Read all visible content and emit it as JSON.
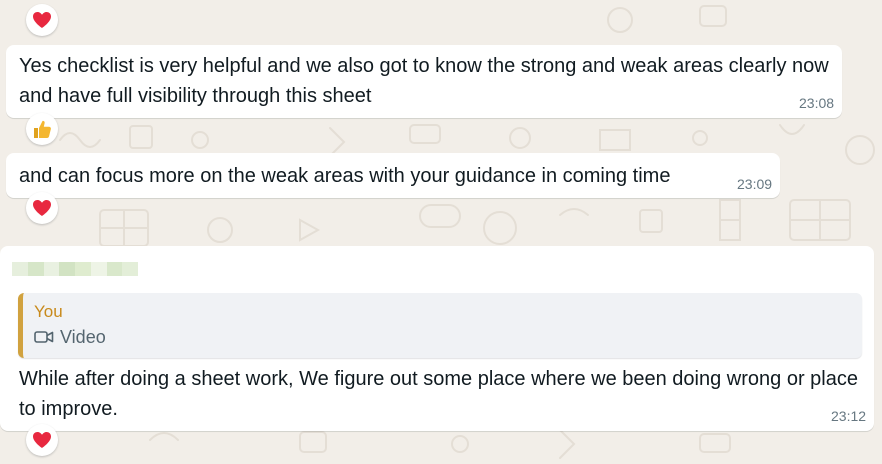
{
  "messages": [
    {
      "text": "Yes checklist is very helpful and we also got to know the strong and weak areas clearly now and have full visibility through this sheet",
      "time": "23:08",
      "reaction": "thumbs-up"
    },
    {
      "text": "and can focus more on the weak areas with your guidance in coming time",
      "time": "23:09",
      "reaction": "red-heart"
    },
    {
      "sender": "",
      "quoted": {
        "author": "You",
        "media_icon": "video-camera-icon",
        "media_label": "Video"
      },
      "text": "While after doing a sheet work, We figure out some place where we been doing wrong or place to improve.",
      "time": "23:12",
      "reaction": "red-heart"
    }
  ],
  "top_reaction": "red-heart",
  "colors": {
    "wallpaper": "#f2eee8",
    "bubble": "#ffffff",
    "quote_bar": "#d1a23f",
    "quote_author": "#c88a1c",
    "timestamp": "#667781",
    "heart": "#e8283f",
    "thumb": "#f4b731"
  }
}
